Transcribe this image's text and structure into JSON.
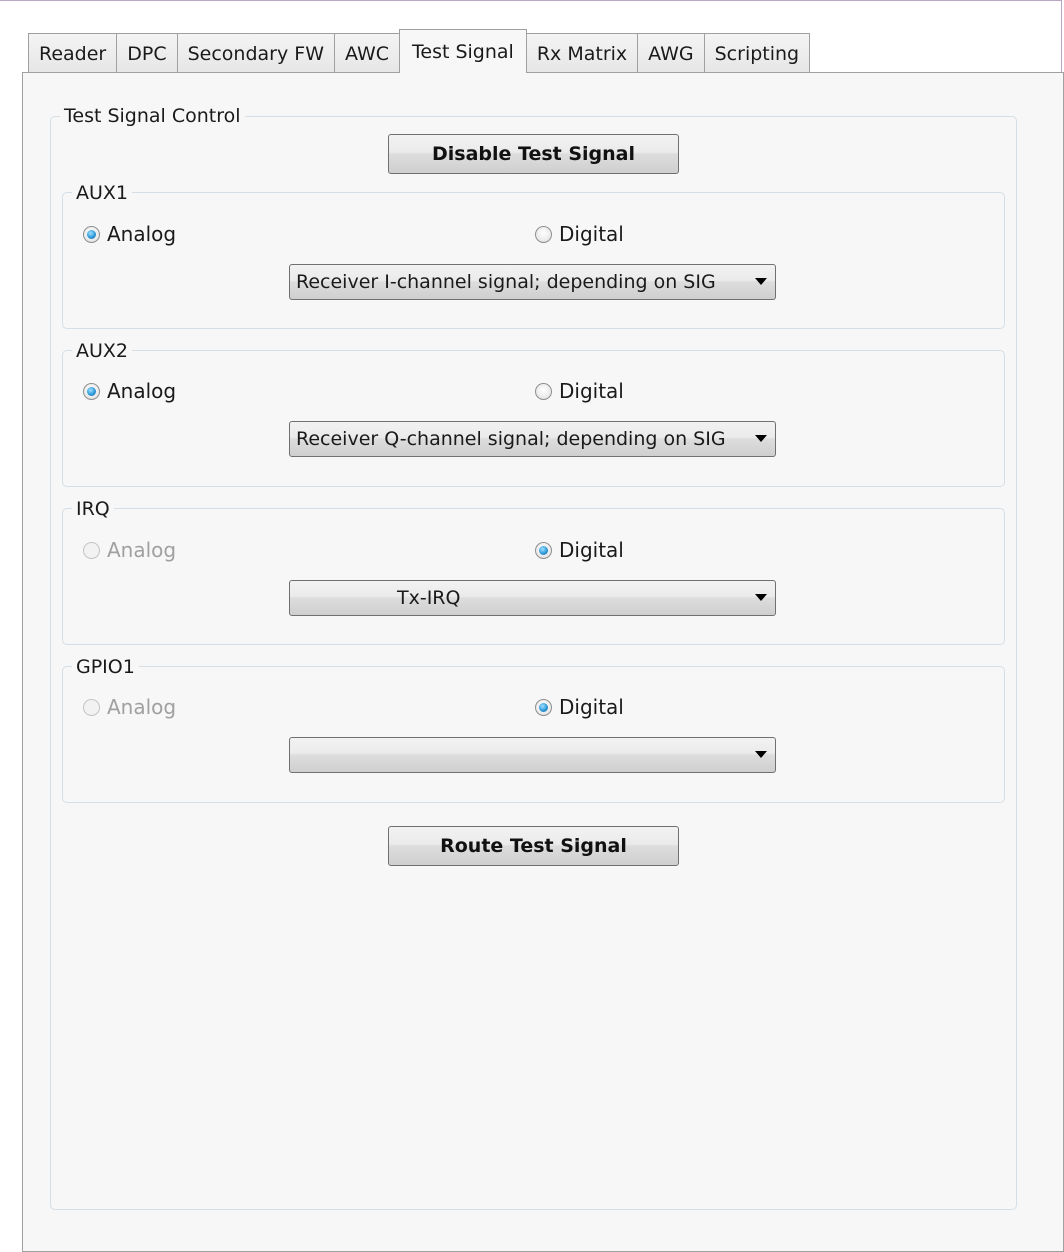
{
  "tabs": [
    {
      "label": "Reader",
      "active": false
    },
    {
      "label": "DPC",
      "active": false
    },
    {
      "label": "Secondary FW",
      "active": false
    },
    {
      "label": "AWC",
      "active": false
    },
    {
      "label": "Test Signal",
      "active": true
    },
    {
      "label": "Rx Matrix",
      "active": false
    },
    {
      "label": "AWG",
      "active": false
    },
    {
      "label": "Scripting",
      "active": false
    }
  ],
  "control": {
    "title": "Test Signal Control",
    "disable_button": "Disable Test Signal",
    "route_button": "Route Test Signal"
  },
  "groups": {
    "aux1": {
      "title": "AUX1",
      "analog_label": "Analog",
      "digital_label": "Digital",
      "selected": "analog",
      "dropdown_value": "Receiver I-channel signal; depending on SIG"
    },
    "aux2": {
      "title": "AUX2",
      "analog_label": "Analog",
      "digital_label": "Digital",
      "selected": "analog",
      "dropdown_value": "Receiver Q-channel signal; depending on SIG"
    },
    "irq": {
      "title": "IRQ",
      "analog_label": "Analog",
      "digital_label": "Digital",
      "selected": "digital",
      "analog_disabled": true,
      "dropdown_value": "Tx-IRQ"
    },
    "gpio1": {
      "title": "GPIO1",
      "analog_label": "Analog",
      "digital_label": "Digital",
      "selected": "digital",
      "analog_disabled": true,
      "dropdown_value": ""
    }
  },
  "colors": {
    "radio_accent": "#2f9ad8",
    "panel_bg": "#f7f7f7",
    "group_border": "#d5dfe5"
  }
}
